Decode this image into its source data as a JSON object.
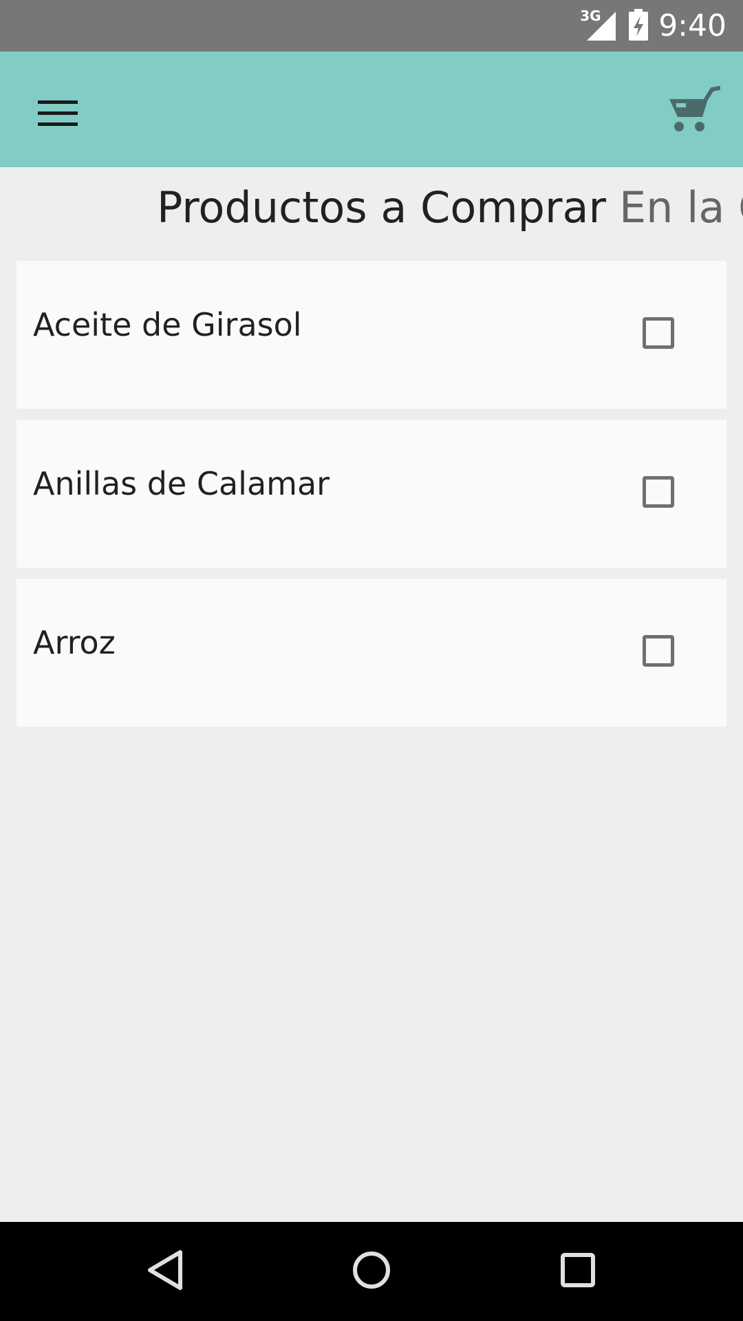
{
  "status_bar": {
    "network": "3G",
    "time": "9:40"
  },
  "toolbar": {
    "menu_icon": "hamburger-menu-icon",
    "cart_icon": "shopping-cart-icon",
    "background_color": "#81cdc6"
  },
  "tabs": [
    {
      "label": "Productos a Comprar",
      "active": true
    },
    {
      "label": "En la C",
      "active": false
    }
  ],
  "products": [
    {
      "name": "Aceite de Girasol",
      "checked": false
    },
    {
      "name": "Anillas de Calamar",
      "checked": false
    },
    {
      "name": "Arroz",
      "checked": false
    }
  ],
  "nav_bar": {
    "back_icon": "back-triangle-icon",
    "home_icon": "home-circle-icon",
    "recents_icon": "recents-square-icon"
  }
}
